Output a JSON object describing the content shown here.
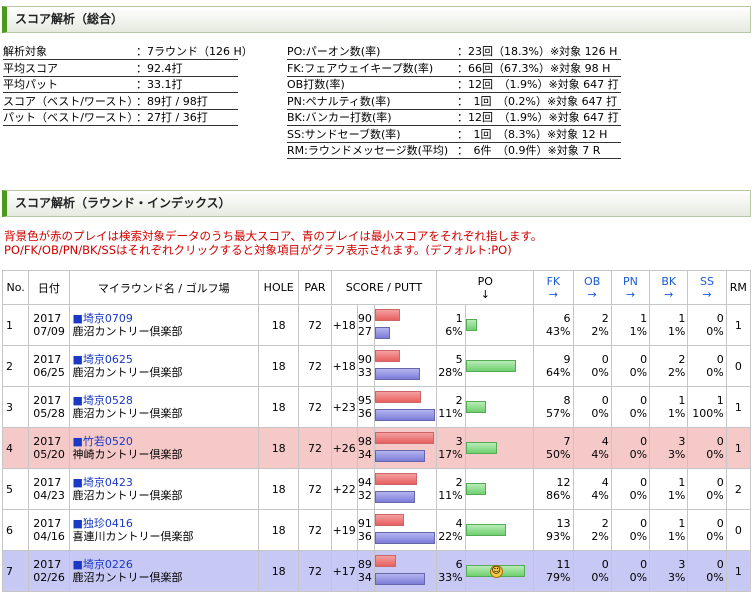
{
  "section1": {
    "title": "スコア解析（総合）"
  },
  "summary_left": [
    {
      "label": "解析対象",
      "value": "：7ラウンド（126 H）"
    },
    {
      "label": "平均スコア",
      "value": "：92.4打"
    },
    {
      "label": "平均パット",
      "value": "：33.1打"
    },
    {
      "label": "スコア（ベスト/ワースト）",
      "value": "：89打 / 98打"
    },
    {
      "label": "パット（ベスト/ワースト）",
      "value": "：27打 / 36打"
    }
  ],
  "summary_right": [
    {
      "label": "PO:パーオン数(率)",
      "value": "：23回（18.3%）※対象 126 H"
    },
    {
      "label": "FK:フェアウェイキープ数(率)",
      "value": "：66回（67.3%）※対象 98 H"
    },
    {
      "label": "OB打数(率)",
      "value": "：12回　（1.9%）※対象 647 打"
    },
    {
      "label": "PN:ペナルティ数(率)",
      "value": "：　1回　（0.2%）※対象 647 打"
    },
    {
      "label": "BK:バンカー打数(率)",
      "value": "：12回　（1.9%）※対象 647 打"
    },
    {
      "label": "SS:サンドセーブ数(率)",
      "value": "：　1回　（8.3%）※対象 12 H"
    },
    {
      "label": "RM:ラウンドメッセージ数(平均)",
      "value": "：　6件　（0.9件）※対象 7 R"
    }
  ],
  "section2": {
    "title": "スコア解析（ラウンド・インデックス）"
  },
  "notes": {
    "line1": "背景色が赤のプレイは検索対象データのうち最大スコア、青のプレイは最小スコアをそれぞれ指します。",
    "line2": "PO/FK/OB/PN/BK/SSはそれぞれクリックすると対象項目がグラフ表示されます。(デフォルト:PO)"
  },
  "table": {
    "headers": {
      "no": "No.",
      "date": "日付",
      "round": "マイラウンド名 / ゴルフ場",
      "hole": "HOLE",
      "par": "PAR",
      "score": "SCORE / PUTT",
      "po": "PO",
      "po_arrow": "↓",
      "fk": "FK",
      "ob": "OB",
      "pn": "PN",
      "bk": "BK",
      "ss": "SS",
      "arrow": "→",
      "rm": "RM"
    },
    "rows": [
      {
        "no": "1",
        "year": "2017",
        "md": "07/09",
        "name": "■埼京0709",
        "course": "鹿沼カントリー倶楽部",
        "hole": "18",
        "par": "72",
        "diff": "+18",
        "score": "90",
        "putt": "27",
        "po": "1",
        "po_pct": "6%",
        "po_rate": 0.06,
        "fk": "6",
        "fk_pct": "43%",
        "ob": "2",
        "ob_pct": "2%",
        "pn": "1",
        "pn_pct": "1%",
        "bk": "1",
        "bk_pct": "1%",
        "ss": "0",
        "ss_pct": "0%",
        "rm": "1",
        "hl": ""
      },
      {
        "no": "2",
        "year": "2017",
        "md": "06/25",
        "name": "■埼京0625",
        "course": "鹿沼カントリー倶楽部",
        "hole": "18",
        "par": "72",
        "diff": "+18",
        "score": "90",
        "putt": "33",
        "po": "5",
        "po_pct": "28%",
        "po_rate": 0.28,
        "fk": "9",
        "fk_pct": "64%",
        "ob": "0",
        "ob_pct": "0%",
        "pn": "0",
        "pn_pct": "0%",
        "bk": "2",
        "bk_pct": "2%",
        "ss": "0",
        "ss_pct": "0%",
        "rm": "0",
        "hl": ""
      },
      {
        "no": "3",
        "year": "2017",
        "md": "05/28",
        "name": "■埼京0528",
        "course": "鹿沼カントリー倶楽部",
        "hole": "18",
        "par": "72",
        "diff": "+23",
        "score": "95",
        "putt": "36",
        "po": "2",
        "po_pct": "11%",
        "po_rate": 0.11,
        "fk": "8",
        "fk_pct": "57%",
        "ob": "0",
        "ob_pct": "0%",
        "pn": "0",
        "pn_pct": "0%",
        "bk": "1",
        "bk_pct": "1%",
        "ss": "1",
        "ss_pct": "100%",
        "rm": "1",
        "hl": ""
      },
      {
        "no": "4",
        "year": "2017",
        "md": "05/20",
        "name": "■竹若0520",
        "course": "神崎カントリー倶楽部",
        "hole": "18",
        "par": "72",
        "diff": "+26",
        "score": "98",
        "putt": "34",
        "po": "3",
        "po_pct": "17%",
        "po_rate": 0.17,
        "fk": "7",
        "fk_pct": "50%",
        "ob": "4",
        "ob_pct": "4%",
        "pn": "0",
        "pn_pct": "0%",
        "bk": "3",
        "bk_pct": "3%",
        "ss": "0",
        "ss_pct": "0%",
        "rm": "1",
        "hl": "red"
      },
      {
        "no": "5",
        "year": "2017",
        "md": "04/23",
        "name": "■埼京0423",
        "course": "鹿沼カントリー倶楽部",
        "hole": "18",
        "par": "72",
        "diff": "+22",
        "score": "94",
        "putt": "32",
        "po": "2",
        "po_pct": "11%",
        "po_rate": 0.11,
        "fk": "12",
        "fk_pct": "86%",
        "ob": "4",
        "ob_pct": "4%",
        "pn": "0",
        "pn_pct": "0%",
        "bk": "1",
        "bk_pct": "1%",
        "ss": "0",
        "ss_pct": "0%",
        "rm": "2",
        "hl": ""
      },
      {
        "no": "6",
        "year": "2017",
        "md": "04/16",
        "name": "■独珍0416",
        "course": "喜連川カントリー倶楽部",
        "hole": "18",
        "par": "72",
        "diff": "+19",
        "score": "91",
        "putt": "36",
        "po": "4",
        "po_pct": "22%",
        "po_rate": 0.22,
        "fk": "13",
        "fk_pct": "93%",
        "ob": "2",
        "ob_pct": "2%",
        "pn": "0",
        "pn_pct": "0%",
        "bk": "1",
        "bk_pct": "1%",
        "ss": "0",
        "ss_pct": "0%",
        "rm": "0",
        "hl": ""
      },
      {
        "no": "7",
        "year": "2017",
        "md": "02/26",
        "name": "■埼京0226",
        "course": "鹿沼カントリー倶楽部",
        "hole": "18",
        "par": "72",
        "diff": "+17",
        "score": "89",
        "putt": "34",
        "po": "6",
        "po_pct": "33%",
        "po_rate": 0.33,
        "fk": "11",
        "fk_pct": "79%",
        "ob": "0",
        "ob_pct": "0%",
        "pn": "0",
        "pn_pct": "0%",
        "bk": "3",
        "bk_pct": "3%",
        "ss": "0",
        "ss_pct": "0%",
        "rm": "1",
        "hl": "blue"
      }
    ]
  }
}
